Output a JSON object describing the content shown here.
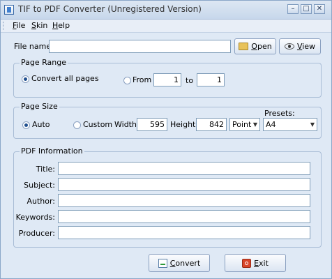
{
  "window": {
    "title": "TIF to PDF Converter (Unregistered Version)",
    "minimize_glyph": "–",
    "maximize_glyph": "□",
    "close_glyph": "✕"
  },
  "menu": {
    "file_u": "F",
    "file_rest": "ile",
    "skin_u": "S",
    "skin_rest": "kin",
    "help_u": "H",
    "help_rest": "elp"
  },
  "file": {
    "label": "File name:",
    "value": "",
    "open_u": "O",
    "open_rest": "pen",
    "view_u": "V",
    "view_rest": "iew"
  },
  "page_range": {
    "legend": "Page Range",
    "all_label": "Convert all pages",
    "all_selected": true,
    "from_label": "From",
    "from_value": "1",
    "to_label": "to",
    "to_value": "1"
  },
  "page_size": {
    "legend": "Page Size",
    "auto_label": "Auto",
    "auto_selected": true,
    "custom_label": "Custom",
    "width_label": "Width",
    "width_value": "595",
    "height_label": "Height",
    "height_value": "842",
    "unit_value": "Point",
    "presets_label": "Presets:",
    "preset_value": "A4"
  },
  "pdf_info": {
    "legend": "PDF Information",
    "title_label": "Title:",
    "title_value": "",
    "subject_label": "Subject:",
    "subject_value": "",
    "author_label": "Author:",
    "author_value": "",
    "keywords_label": "Keywords:",
    "keywords_value": "",
    "producer_label": "Producer:",
    "producer_value": ""
  },
  "actions": {
    "convert_u": "C",
    "convert_rest": "onvert",
    "exit_u": "E",
    "exit_rest": "xit"
  },
  "icons": {
    "app": "app-icon",
    "open": "folder-icon",
    "view": "eye-icon",
    "convert": "convert-icon",
    "exit": "exit-icon"
  }
}
